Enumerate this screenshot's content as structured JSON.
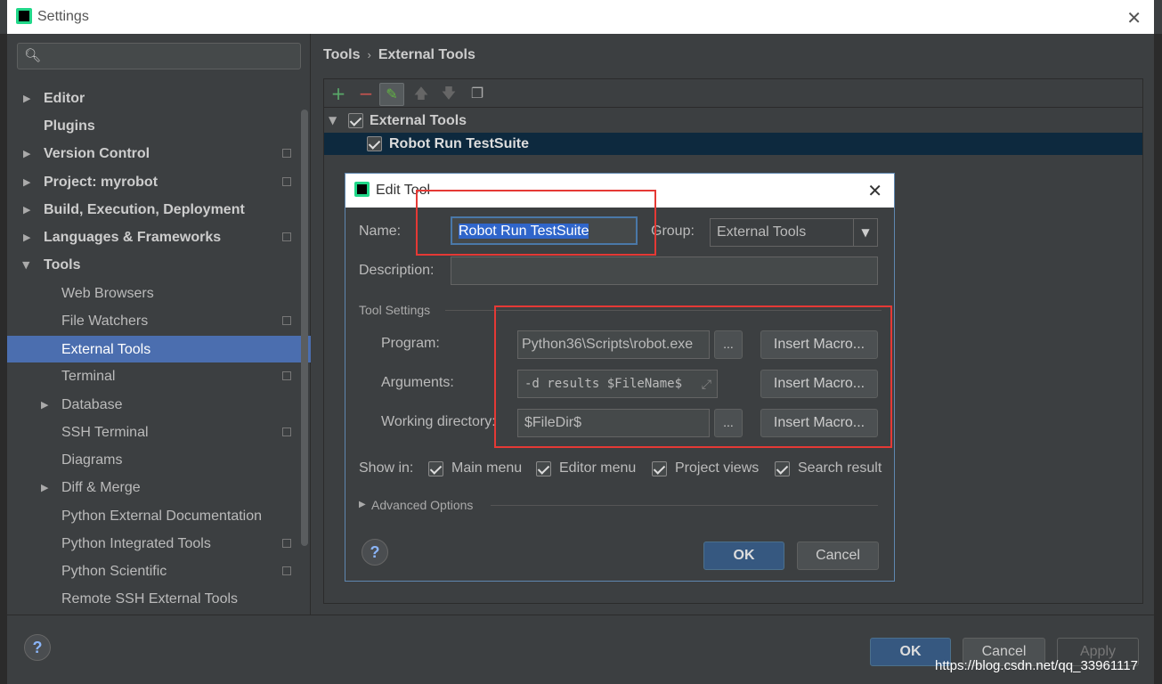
{
  "window": {
    "title": "Settings"
  },
  "search": {
    "placeholder": ""
  },
  "sidebar": {
    "items": [
      {
        "label": "Editor"
      },
      {
        "label": "Plugins"
      },
      {
        "label": "Version Control"
      },
      {
        "label": "Project: myrobot"
      },
      {
        "label": "Build, Execution, Deployment"
      },
      {
        "label": "Languages & Frameworks"
      },
      {
        "label": "Tools"
      },
      {
        "label": "Web Browsers"
      },
      {
        "label": "File Watchers"
      },
      {
        "label": "External Tools"
      },
      {
        "label": "Terminal"
      },
      {
        "label": "Database"
      },
      {
        "label": "SSH Terminal"
      },
      {
        "label": "Diagrams"
      },
      {
        "label": "Diff & Merge"
      },
      {
        "label": "Python External Documentation"
      },
      {
        "label": "Python Integrated Tools"
      },
      {
        "label": "Python Scientific"
      },
      {
        "label": "Remote SSH External Tools"
      }
    ]
  },
  "breadcrumb": {
    "parent": "Tools",
    "current": "External Tools"
  },
  "tool_tree": {
    "group": "External Tools",
    "tool": "Robot Run TestSuite"
  },
  "dialog": {
    "title": "Edit Tool",
    "name_label": "Name:",
    "name_value": "Robot Run TestSuite",
    "group_label": "Group:",
    "group_value": "External Tools",
    "description_label": "Description:",
    "description_value": "",
    "tool_settings": "Tool Settings",
    "program_label": "Program:",
    "program_value": "Python36\\Scripts\\robot.exe",
    "arguments_label": "Arguments:",
    "arguments_value": "-d results $FileName$",
    "workdir_label": "Working directory:",
    "workdir_value": "$FileDir$",
    "browse": "...",
    "insert_macro": "Insert Macro...",
    "show_in_label": "Show in:",
    "show_in": [
      "Main menu",
      "Editor menu",
      "Project views",
      "Search result"
    ],
    "advanced": "Advanced Options",
    "ok": "OK",
    "cancel": "Cancel",
    "help": "?"
  },
  "footer": {
    "ok": "OK",
    "cancel": "Cancel",
    "apply": "Apply",
    "help": "?"
  },
  "watermark": "https://blog.csdn.net/qq_33961117",
  "colors": {
    "accent": "#4b6eaf",
    "highlight_box": "#e53935",
    "add": "#59a869",
    "remove": "#c75450"
  }
}
